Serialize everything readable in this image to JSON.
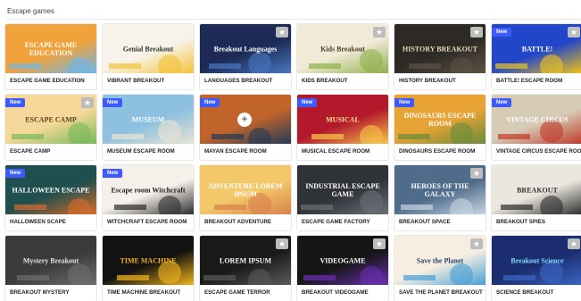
{
  "section": {
    "title": "Escape games"
  },
  "labels": {
    "new_badge": "New",
    "favorite_icon": "star-icon"
  },
  "cards": [
    {
      "title": "ESCAPE GAME EDUCATION",
      "thumb_text": "ESCAPE GAME EDUCATION",
      "bg": "#f2a23a",
      "bg2": "#6fb6e8",
      "fg": "#ffffff",
      "new": false,
      "fav": false
    },
    {
      "title": "VIBRANT BREAKOUT",
      "thumb_text": "Genial Breakout",
      "bg": "#f7f3ea",
      "bg2": "#f4c33a",
      "fg": "#333333",
      "new": false,
      "fav": false
    },
    {
      "title": "LANGUAGES BREAKOUT",
      "thumb_text": "Breakout Languages",
      "bg": "#1c2a55",
      "bg2": "#4a78c2",
      "fg": "#ffffff",
      "new": false,
      "fav": true
    },
    {
      "title": "KIDS BREAKOUT",
      "thumb_text": "Kids Breakout",
      "bg": "#f1ead7",
      "bg2": "#8fb04c",
      "fg": "#4a3b22",
      "new": false,
      "fav": true
    },
    {
      "title": "HISTORY BREAKOUT",
      "thumb_text": "HISTORY BREAKOUT",
      "bg": "#2d2a25",
      "bg2": "#5c5245",
      "fg": "#e6d8b8",
      "new": false,
      "fav": true
    },
    {
      "title": "BATTLE! ESCAPE ROOM",
      "thumb_text": "BATTLE!",
      "bg": "#2146c9",
      "bg2": "#f0c419",
      "fg": "#ffffff",
      "new": true,
      "fav": true
    },
    {
      "title": "ESCAPE CAMP",
      "thumb_text": "ESCAPE CAMP",
      "bg": "#f6d99a",
      "bg2": "#79b957",
      "fg": "#5a3e1b",
      "new": true,
      "fav": true
    },
    {
      "title": "MUSEUM ESCAPE ROOM",
      "thumb_text": "MUSEUM",
      "bg": "#8ec1e0",
      "bg2": "#e9e3d3",
      "fg": "#ffffff",
      "new": true,
      "fav": false
    },
    {
      "title": "MAYAN ESCAPE ROOM",
      "thumb_text": "",
      "bg": "#c0642b",
      "bg2": "#233a55",
      "fg": "#ffffff",
      "new": true,
      "fav": false
    },
    {
      "title": "MUSICAL ESCAPE ROOM",
      "thumb_text": "MUSICAL",
      "bg": "#b3182b",
      "bg2": "#f7c64a",
      "fg": "#ffe08a",
      "new": true,
      "fav": false
    },
    {
      "title": "DINOSAURS ESCAPE ROOM",
      "thumb_text": "DINOSAURS ESCAPE ROOM",
      "bg": "#e7a334",
      "bg2": "#6a8c3a",
      "fg": "#ffffff",
      "new": true,
      "fav": false
    },
    {
      "title": "VINTAGE CIRCUS ESCAPE ROOM",
      "thumb_text": "VINTAGE CIRCUS",
      "bg": "#d6ccb6",
      "bg2": "#c0392b",
      "fg": "#ffffff",
      "new": true,
      "fav": false
    },
    {
      "title": "HALLOWEEN SCAPE",
      "thumb_text": "HALLOWEEN ESCAPE",
      "bg": "#1f4f4f",
      "bg2": "#d96b2a",
      "fg": "#ffffff",
      "new": true,
      "fav": false
    },
    {
      "title": "WITCHCRAFT ESCAPE ROOM",
      "thumb_text": "Escape room Witchcraft",
      "bg": "#f5f0ea",
      "bg2": "#2d2d2d",
      "fg": "#222222",
      "new": true,
      "fav": false
    },
    {
      "title": "BREAKOUT ADVENTURE",
      "thumb_text": "ADVENTURE LOREM IPSUM",
      "bg": "#f3c86b",
      "bg2": "#d9824b",
      "fg": "#ffffff",
      "new": false,
      "fav": false
    },
    {
      "title": "ESCAPE GAME FACTORY",
      "thumb_text": "INDUSTRIAL ESCAPE GAME",
      "bg": "#2f3237",
      "bg2": "#6b7078",
      "fg": "#ffffff",
      "new": false,
      "fav": false
    },
    {
      "title": "BREAKOUT SPACE",
      "thumb_text": "HEROES OF THE GALAXY",
      "bg": "#4f6c8a",
      "bg2": "#c7d6e3",
      "fg": "#ffffff",
      "new": false,
      "fav": true
    },
    {
      "title": "BREAKOUT SPIES",
      "thumb_text": "BREAKOUT",
      "bg": "#eae7df",
      "bg2": "#2d2d2d",
      "fg": "#333333",
      "new": false,
      "fav": false
    },
    {
      "title": "BREAKOUT MYSTERY",
      "thumb_text": "Mystery Breakout",
      "bg": "#3a3b3d",
      "bg2": "#6d6e70",
      "fg": "#e5e5e5",
      "new": false,
      "fav": false
    },
    {
      "title": "TIME MACHINE BREAKOUT",
      "thumb_text": "TIME MACHINE",
      "bg": "#121212",
      "bg2": "#f2b51d",
      "fg": "#f2b51d",
      "new": false,
      "fav": false
    },
    {
      "title": "ESCAPE GAME TERROR",
      "thumb_text": "LOREM IPSUM",
      "bg": "#1a1a1a",
      "bg2": "#5a5a5a",
      "fg": "#ffffff",
      "new": false,
      "fav": true
    },
    {
      "title": "BREAKOUT VIDEOGAME",
      "thumb_text": "VIDEOGAME",
      "bg": "#161616",
      "bg2": "#6b2fb3",
      "fg": "#ffffff",
      "new": false,
      "fav": true
    },
    {
      "title": "SAVE THE PLANET BREAKOUT",
      "thumb_text": "Save the Planet",
      "bg": "#f6efe1",
      "bg2": "#4a9fd6",
      "fg": "#2b3f6b",
      "new": false,
      "fav": true
    },
    {
      "title": "SCIENCE BREAKOUT",
      "thumb_text": "Breakout Science",
      "bg": "#1b2d6e",
      "bg2": "#3c65c4",
      "fg": "#7be0ff",
      "new": false,
      "fav": true
    }
  ]
}
